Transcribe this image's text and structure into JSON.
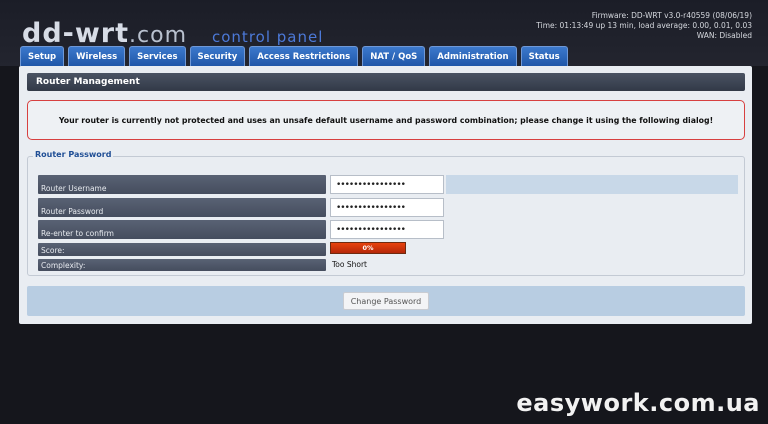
{
  "header": {
    "logo_main": "dd-wrt",
    "logo_suffix": ".com",
    "subtitle": "control panel",
    "firmware": "Firmware: DD-WRT v3.0-r40559 (08/06/19)",
    "time": "Time: 01:13:49 up 13 min, load average: 0.00, 0.01, 0.03",
    "wan": "WAN: Disabled"
  },
  "tabs": [
    "Setup",
    "Wireless",
    "Services",
    "Security",
    "Access Restrictions",
    "NAT / QoS",
    "Administration",
    "Status"
  ],
  "section": {
    "title": "Router Management",
    "warning": "Your router is currently not protected and uses an unsafe default username and password combination; please change it using the following dialog!"
  },
  "router_password": {
    "legend": "Router Password",
    "username_label": "Router Username",
    "username_value": "••••••••••••••••",
    "password_label": "Router Password",
    "password_value": "••••••••••••••••",
    "confirm_label": "Re-enter to confirm",
    "confirm_value": "••••••••••••••••",
    "score_label": "Score:",
    "score_value": "0%",
    "complexity_label": "Complexity:",
    "complexity_value": "Too Short"
  },
  "footer": {
    "change_password_label": "Change Password"
  },
  "watermark": "easywork.com.ua",
  "colors": {
    "tab_blue": "#2f67b8",
    "warning_border": "#d74040",
    "score_red": "#d9360c"
  }
}
